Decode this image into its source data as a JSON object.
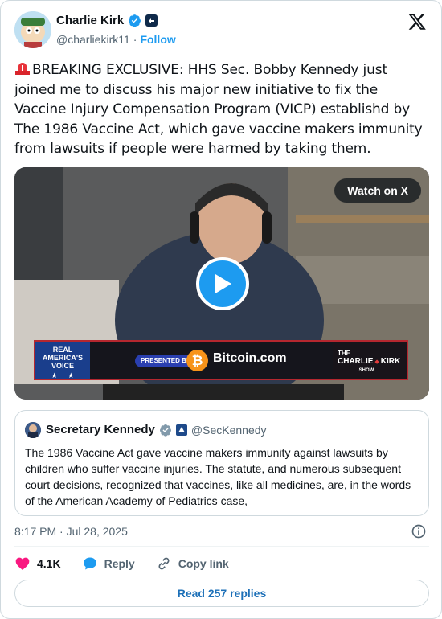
{
  "author": {
    "name": "Charlie Kirk",
    "handle": "@charliekirk11",
    "separator": "·",
    "follow_label": "Follow"
  },
  "tweet": {
    "text": "BREAKING EXCLUSIVE: HHS Sec. Bobby Kennedy just joined me to discuss his major new initiative to fix the Vaccine Injury Compensation Program (VICP) establishd by The 1986 Vaccine Act, which gave vaccine makers immunity from lawsuits if people were harmed by taking them."
  },
  "media": {
    "watch_label": "Watch on X",
    "banner": {
      "network_line1": "REAL",
      "network_line2": "AMERICA'S",
      "network_line3": "VOICE",
      "presented_by": "PRESENTED BY:",
      "sponsor": "Bitcoin.com",
      "coin_symbol": "₿",
      "show_line1": "THE",
      "show_line2a": "CHARLIE",
      "show_line2b": "KIRK",
      "show_line3": "SHOW"
    }
  },
  "quote": {
    "name": "Secretary Kennedy",
    "handle": "@SecKennedy",
    "text": "The 1986 Vaccine Act gave vaccine makers immunity against lawsuits by children who suffer vaccine injuries. The statute, and numerous subsequent court decisions, recognized that vaccines, like all medicines, are, in the words of the American Academy of Pediatrics case,"
  },
  "meta": {
    "timestamp": "8:17 PM · Jul 28, 2025"
  },
  "actions": {
    "like_count": "4.1K",
    "reply_label": "Reply",
    "copy_label": "Copy link"
  },
  "read_replies_label": "Read 257 replies",
  "colors": {
    "accent": "#1d9bf0",
    "like": "#f91880",
    "text": "#0f1419",
    "muted": "#536471"
  },
  "icons": [
    "verified-badge-icon",
    "affiliate-badge-icon",
    "x-logo-icon",
    "siren-emoji-icon",
    "play-icon",
    "info-icon",
    "heart-icon",
    "reply-bubble-icon",
    "link-icon"
  ]
}
